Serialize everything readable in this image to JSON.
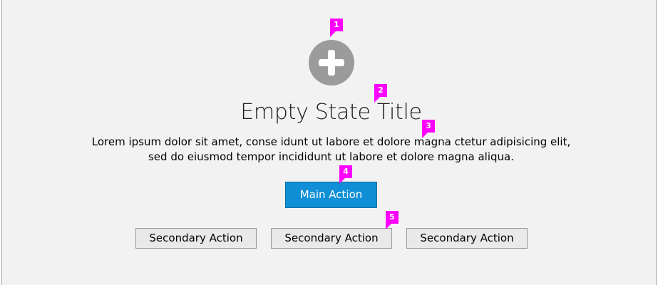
{
  "empty_state": {
    "icon": "plus-circle-icon",
    "title": "Empty State Title",
    "description_line1": "Lorem ipsum dolor sit amet, conse idunt ut labore et dolore magna  ctetur adipisicing elit,",
    "description_line2": "sed do eiusmod tempor incididunt ut labore et dolore magna aliqua.",
    "main_action_label": "Main Action",
    "secondary_actions": [
      {
        "label": "Secondary Action"
      },
      {
        "label": "Secondary Action"
      },
      {
        "label": "Secondary Action"
      }
    ]
  },
  "annotation_markers": [
    {
      "label": "1"
    },
    {
      "label": "2"
    },
    {
      "label": "3"
    },
    {
      "label": "4"
    },
    {
      "label": "5"
    }
  ],
  "colors": {
    "panel_background": "#f2f2f2",
    "icon": "#9b9b9b",
    "main_button": "#0e8fd6",
    "secondary_button": "#e9e9e9",
    "marker": "#ff00ff"
  }
}
